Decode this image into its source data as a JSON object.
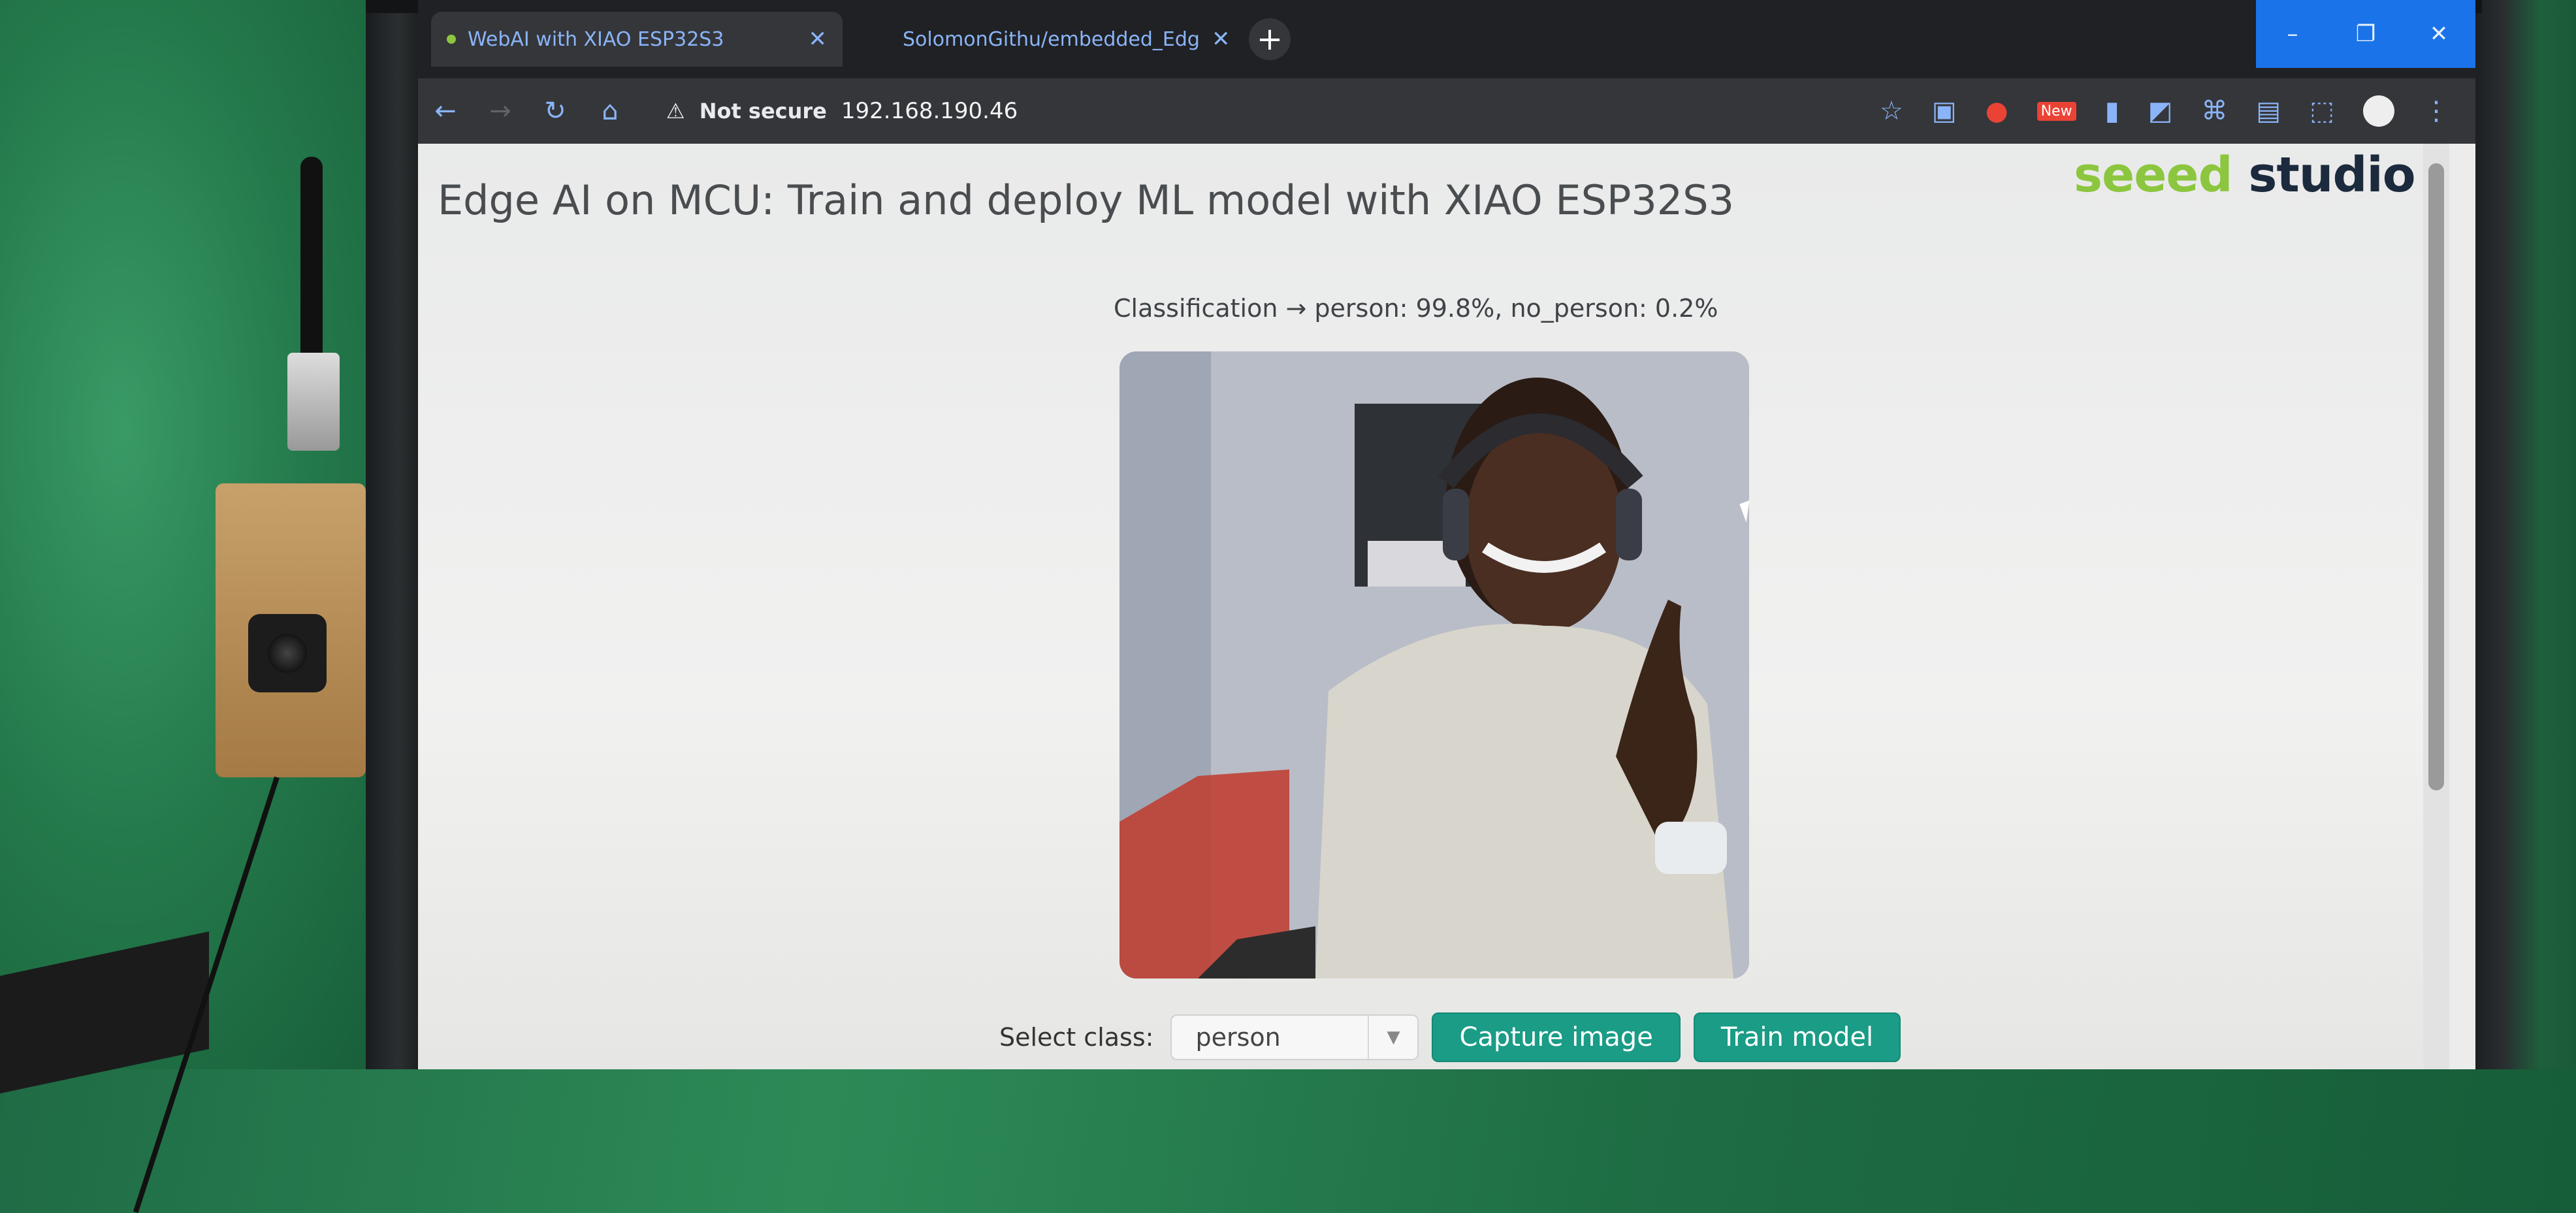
{
  "browser": {
    "tabs": [
      {
        "label": "WebAI with XIAO ESP32S3",
        "active": true
      },
      {
        "label": "SolomonGithu/embedded_Edg",
        "active": false
      }
    ],
    "new_tab": "+",
    "window_controls": {
      "minimize": "–",
      "restore": "❐",
      "close": "✕"
    },
    "security_label": "Not secure",
    "url": "192.168.190.46",
    "extension_badge": "New"
  },
  "page": {
    "title": "Edge AI on MCU: Train and deploy ML model with XIAO ESP32S3",
    "logo": {
      "part1": "seeed",
      "part2": "studio"
    },
    "classification": "Classification → person: 99.8%, no_person: 0.2%",
    "controls": {
      "select_label": "Select class:",
      "selected_class": "person",
      "capture_button": "Capture image",
      "train_button": "Train model"
    }
  },
  "colors": {
    "accent_button": "#1a9c86",
    "logo_green": "#8cc63f",
    "logo_dark": "#1b2a3d",
    "window_controls": "#1a73e8"
  },
  "icons": [
    "back-icon",
    "forward-icon",
    "reload-icon",
    "home-icon",
    "warning-icon",
    "star-icon",
    "extension-icon",
    "profile-avatar",
    "menu-icon",
    "github-icon"
  ]
}
